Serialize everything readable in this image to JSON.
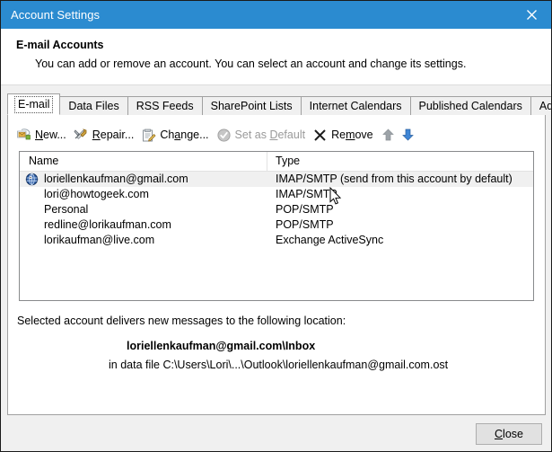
{
  "window": {
    "title": "Account Settings",
    "close_icon": "close-icon",
    "titlebar_color": "#2b8bd0"
  },
  "header": {
    "title": "E-mail Accounts",
    "subtitle": "You can add or remove an account. You can select an account and change its settings."
  },
  "tabs": [
    {
      "label": "E-mail",
      "active": true
    },
    {
      "label": "Data Files",
      "active": false
    },
    {
      "label": "RSS Feeds",
      "active": false
    },
    {
      "label": "SharePoint Lists",
      "active": false
    },
    {
      "label": "Internet Calendars",
      "active": false
    },
    {
      "label": "Published Calendars",
      "active": false
    },
    {
      "label": "Address Books",
      "active": false
    }
  ],
  "toolbar": {
    "new": {
      "label": "New...",
      "accel": "N",
      "icon": "new-email-account-icon",
      "disabled": false
    },
    "repair": {
      "label": "Repair...",
      "accel": "R",
      "icon": "repair-tools-icon",
      "disabled": false
    },
    "change": {
      "label": "Change...",
      "accel": "a",
      "icon": "change-account-icon",
      "disabled": false
    },
    "set_as_default": {
      "label": "Set as Default",
      "accel": "D",
      "icon": "check-circle-icon",
      "disabled": true
    },
    "remove": {
      "label": "Remove",
      "accel": "m",
      "icon": "x-mark-icon",
      "disabled": false
    },
    "move_up": {
      "icon": "arrow-up-icon",
      "disabled": true
    },
    "move_down": {
      "icon": "arrow-down-icon",
      "disabled": false
    }
  },
  "list": {
    "columns": [
      "Name",
      "Type"
    ],
    "rows": [
      {
        "name": "loriellenkaufman@gmail.com",
        "type": "IMAP/SMTP (send from this account by default)",
        "selected": true,
        "icon": "account-globe-icon"
      },
      {
        "name": "lori@howtogeek.com",
        "type": "IMAP/SMTP",
        "selected": false,
        "icon": ""
      },
      {
        "name": "Personal",
        "type": "POP/SMTP",
        "selected": false,
        "icon": ""
      },
      {
        "name": "redline@lorikaufman.com",
        "type": "POP/SMTP",
        "selected": false,
        "icon": ""
      },
      {
        "name": "lorikaufman@live.com",
        "type": "Exchange ActiveSync",
        "selected": false,
        "icon": ""
      }
    ]
  },
  "delivery": {
    "label": "Selected account delivers new messages to the following location:",
    "target": "loriellenkaufman@gmail.com\\Inbox",
    "data_file": "in data file C:\\Users\\Lori\\...\\Outlook\\loriellenkaufman@gmail.com.ost"
  },
  "footer": {
    "close_label": "Close",
    "close_accel": "C"
  }
}
